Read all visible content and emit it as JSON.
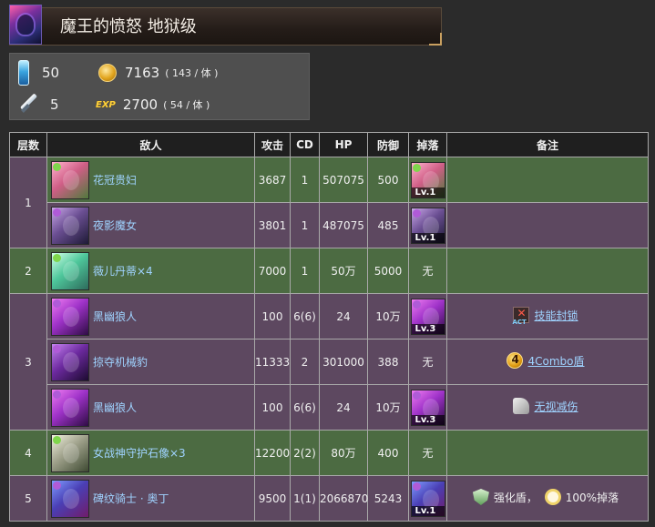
{
  "header": {
    "title": "魔王的愤怒 地狱级"
  },
  "cost": {
    "stamina": "50",
    "battles": "5",
    "gold": "7163",
    "gold_per": "( 143 / 体 )",
    "exp": "2700",
    "exp_per": "( 54 / 体 )",
    "exp_label": "EXP"
  },
  "table": {
    "headers": [
      "层数",
      "敌人",
      "攻击",
      "CD",
      "HP",
      "防御",
      "掉落",
      "备注"
    ],
    "rows": [
      {
        "floor": "1",
        "name": "花冠贵妇",
        "atk": "3687",
        "cd": "1",
        "hp": "507075",
        "def": "500",
        "drop": "Lv.1",
        "note1": "",
        "note2": ""
      },
      {
        "floor": "",
        "name": "夜影魔女",
        "atk": "3801",
        "cd": "1",
        "hp": "487075",
        "def": "485",
        "drop": "Lv.1",
        "note1": "",
        "note2": ""
      },
      {
        "floor": "2",
        "name": "薇儿丹蒂×4",
        "atk": "7000",
        "cd": "1",
        "hp": "50万",
        "def": "5000",
        "drop": "无",
        "note1": "",
        "note2": ""
      },
      {
        "floor": "3",
        "name": "黑幽狼人",
        "atk": "100",
        "cd": "6(6)",
        "hp": "24",
        "def": "10万",
        "drop": "Lv.3",
        "note1": "技能封锁",
        "note2": ""
      },
      {
        "floor": "",
        "name": "掠夺机械豹",
        "atk": "11333",
        "cd": "2",
        "hp": "301000",
        "def": "388",
        "drop": "无",
        "note1": "4Combo盾",
        "note2": ""
      },
      {
        "floor": "",
        "name": "黑幽狼人",
        "atk": "100",
        "cd": "6(6)",
        "hp": "24",
        "def": "10万",
        "drop": "Lv.3",
        "note1": "无视减伤",
        "note2": ""
      },
      {
        "floor": "4",
        "name": "女战神守护石像×3",
        "atk": "12200",
        "cd": "2(2)",
        "hp": "80万",
        "def": "400",
        "drop": "无",
        "note1": "",
        "note2": ""
      },
      {
        "floor": "5",
        "name": "碑纹骑士 · 奥丁",
        "atk": "9500",
        "cd": "1(1)",
        "hp": "2066870",
        "def": "5243",
        "drop": "Lv.1",
        "note1": "强化盾，",
        "note2": "100%掉落"
      }
    ]
  },
  "colors": {
    "green_row": "#4c6b42",
    "purple_row": "#5d4860",
    "link": "#9fd3ff"
  }
}
